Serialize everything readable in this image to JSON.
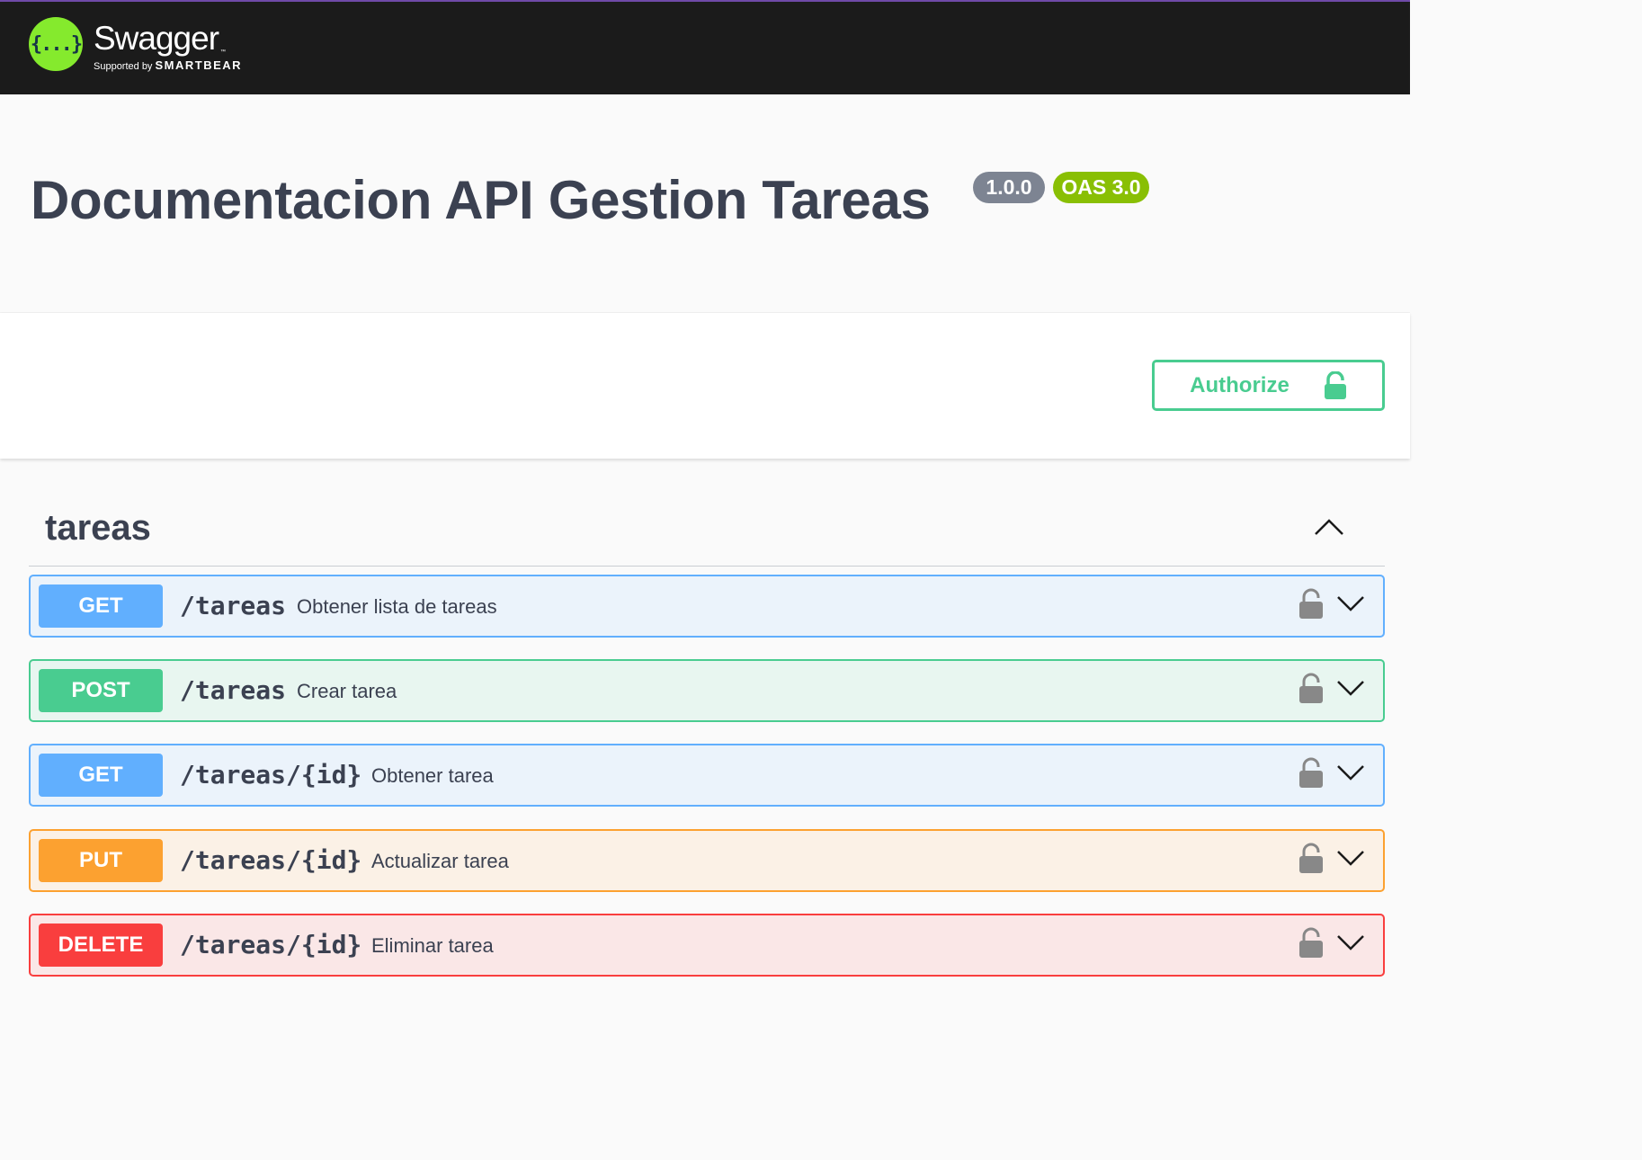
{
  "topbar": {
    "logo_glyph": "{...}",
    "brand_name": "Swagger",
    "brand_tm": "™",
    "supported_by": "Supported by",
    "smartbear": "SMARTBEAR",
    "accent_color": "#85ea2d"
  },
  "info": {
    "title": "Documentacion API Gestion Tareas",
    "version": "1.0.0",
    "oas": "OAS 3.0"
  },
  "scheme": {
    "authorize_label": "Authorize",
    "authorize_icon": "unlock-icon",
    "authorize_color": "#49cc90"
  },
  "tag": {
    "name": "tareas",
    "expanded": true,
    "toggle_icon": "chevron-up-icon"
  },
  "operations": [
    {
      "method": "GET",
      "path": "/tareas",
      "summary": "Obtener lista de tareas",
      "color": "#61affe"
    },
    {
      "method": "POST",
      "path": "/tareas",
      "summary": "Crear tarea",
      "color": "#49cc90"
    },
    {
      "method": "GET",
      "path": "/tareas/{id}",
      "summary": "Obtener tarea",
      "color": "#61affe"
    },
    {
      "method": "PUT",
      "path": "/tareas/{id}",
      "summary": "Actualizar tarea",
      "color": "#fca130"
    },
    {
      "method": "DELETE",
      "path": "/tareas/{id}",
      "summary": "Eliminar tarea",
      "color": "#f93e3e"
    }
  ]
}
